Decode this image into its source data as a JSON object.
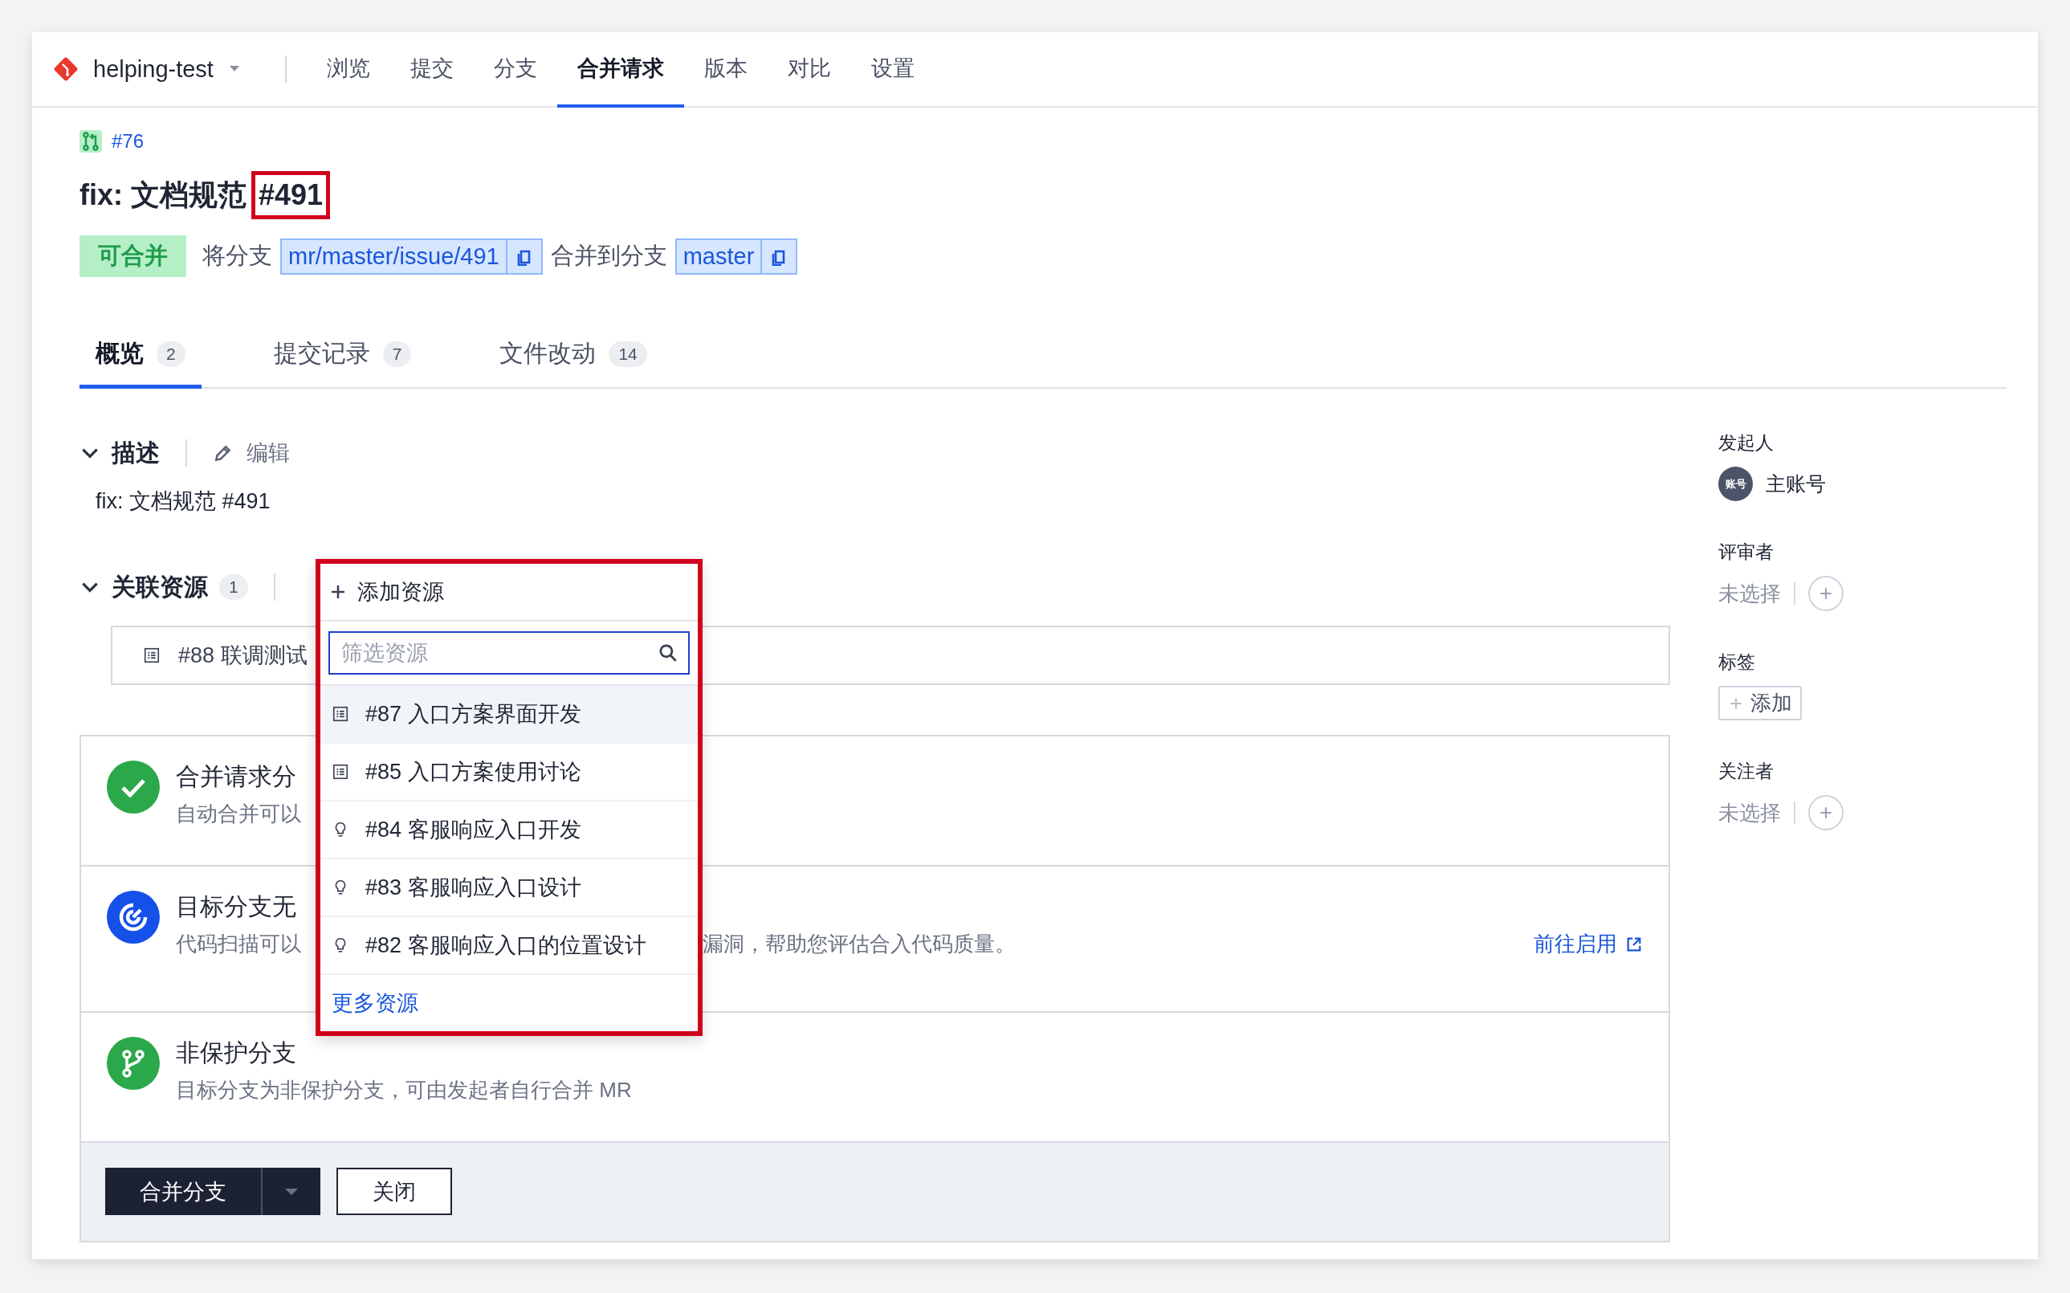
{
  "header": {
    "project": "helping-test",
    "nav": [
      {
        "label": "浏览",
        "selected": false
      },
      {
        "label": "提交",
        "selected": false
      },
      {
        "label": "分支",
        "selected": false
      },
      {
        "label": "合并请求",
        "selected": true
      },
      {
        "label": "版本",
        "selected": false
      },
      {
        "label": "对比",
        "selected": false
      },
      {
        "label": "设置",
        "selected": false
      }
    ]
  },
  "merge_request": {
    "number": "#76",
    "title": "fix: 文档规范",
    "title_ref": "#491",
    "status": "可合并",
    "source_label": "将分支",
    "source_branch": "mr/master/issue/491",
    "target_label": "合并到分支",
    "target_branch": "master"
  },
  "tabs": [
    {
      "label": "概览",
      "count": "2",
      "selected": true
    },
    {
      "label": "提交记录",
      "count": "7",
      "selected": false
    },
    {
      "label": "文件改动",
      "count": "14",
      "selected": false
    }
  ],
  "description": {
    "title": "描述",
    "edit": "编辑",
    "text": "fix: 文档规范 #491",
    "expanded": true
  },
  "resources": {
    "title": "关联资源",
    "count": "1",
    "expanded": true,
    "items": [
      {
        "kind": "task",
        "text": "#88 联调测试"
      }
    ]
  },
  "resource_dropdown": {
    "add": "添加资源",
    "search": {
      "placeholder": "筛选资源"
    },
    "items": [
      {
        "kind": "task",
        "text": "#87 入口方案界面开发",
        "selected": true
      },
      {
        "kind": "task",
        "text": "#85 入口方案使用讨论",
        "selected": false
      },
      {
        "kind": "idea",
        "text": "#84 客服响应入口开发",
        "selected": false
      },
      {
        "kind": "idea",
        "text": "#83 客服响应入口设计",
        "selected": false
      },
      {
        "kind": "idea",
        "text": "#82 客服响应入口的位置设计",
        "selected": false
      }
    ],
    "more": "更多资源"
  },
  "checks": [
    {
      "kind": "success",
      "title": "合并请求分",
      "description": "自动合并可以"
    },
    {
      "kind": "scan",
      "title": "目标分支无",
      "description": "代码扫描可以",
      "description_tail": "漏洞，帮助您评估合入代码质量。",
      "link": "前往启用"
    },
    {
      "kind": "branch",
      "title": "非保护分支",
      "description": "目标分支为非保护分支，可由发起者自行合并 MR"
    }
  ],
  "actions": {
    "merge": "合并分支",
    "close": "关闭"
  },
  "sidebar": {
    "initiator": {
      "label": "发起人",
      "avatar": "账号",
      "name": "主账号"
    },
    "reviewers": {
      "label": "评审者",
      "value": "未选择"
    },
    "labels": {
      "label": "标签",
      "add": "添加"
    },
    "watchers": {
      "label": "关注者",
      "value": "未选择"
    }
  }
}
